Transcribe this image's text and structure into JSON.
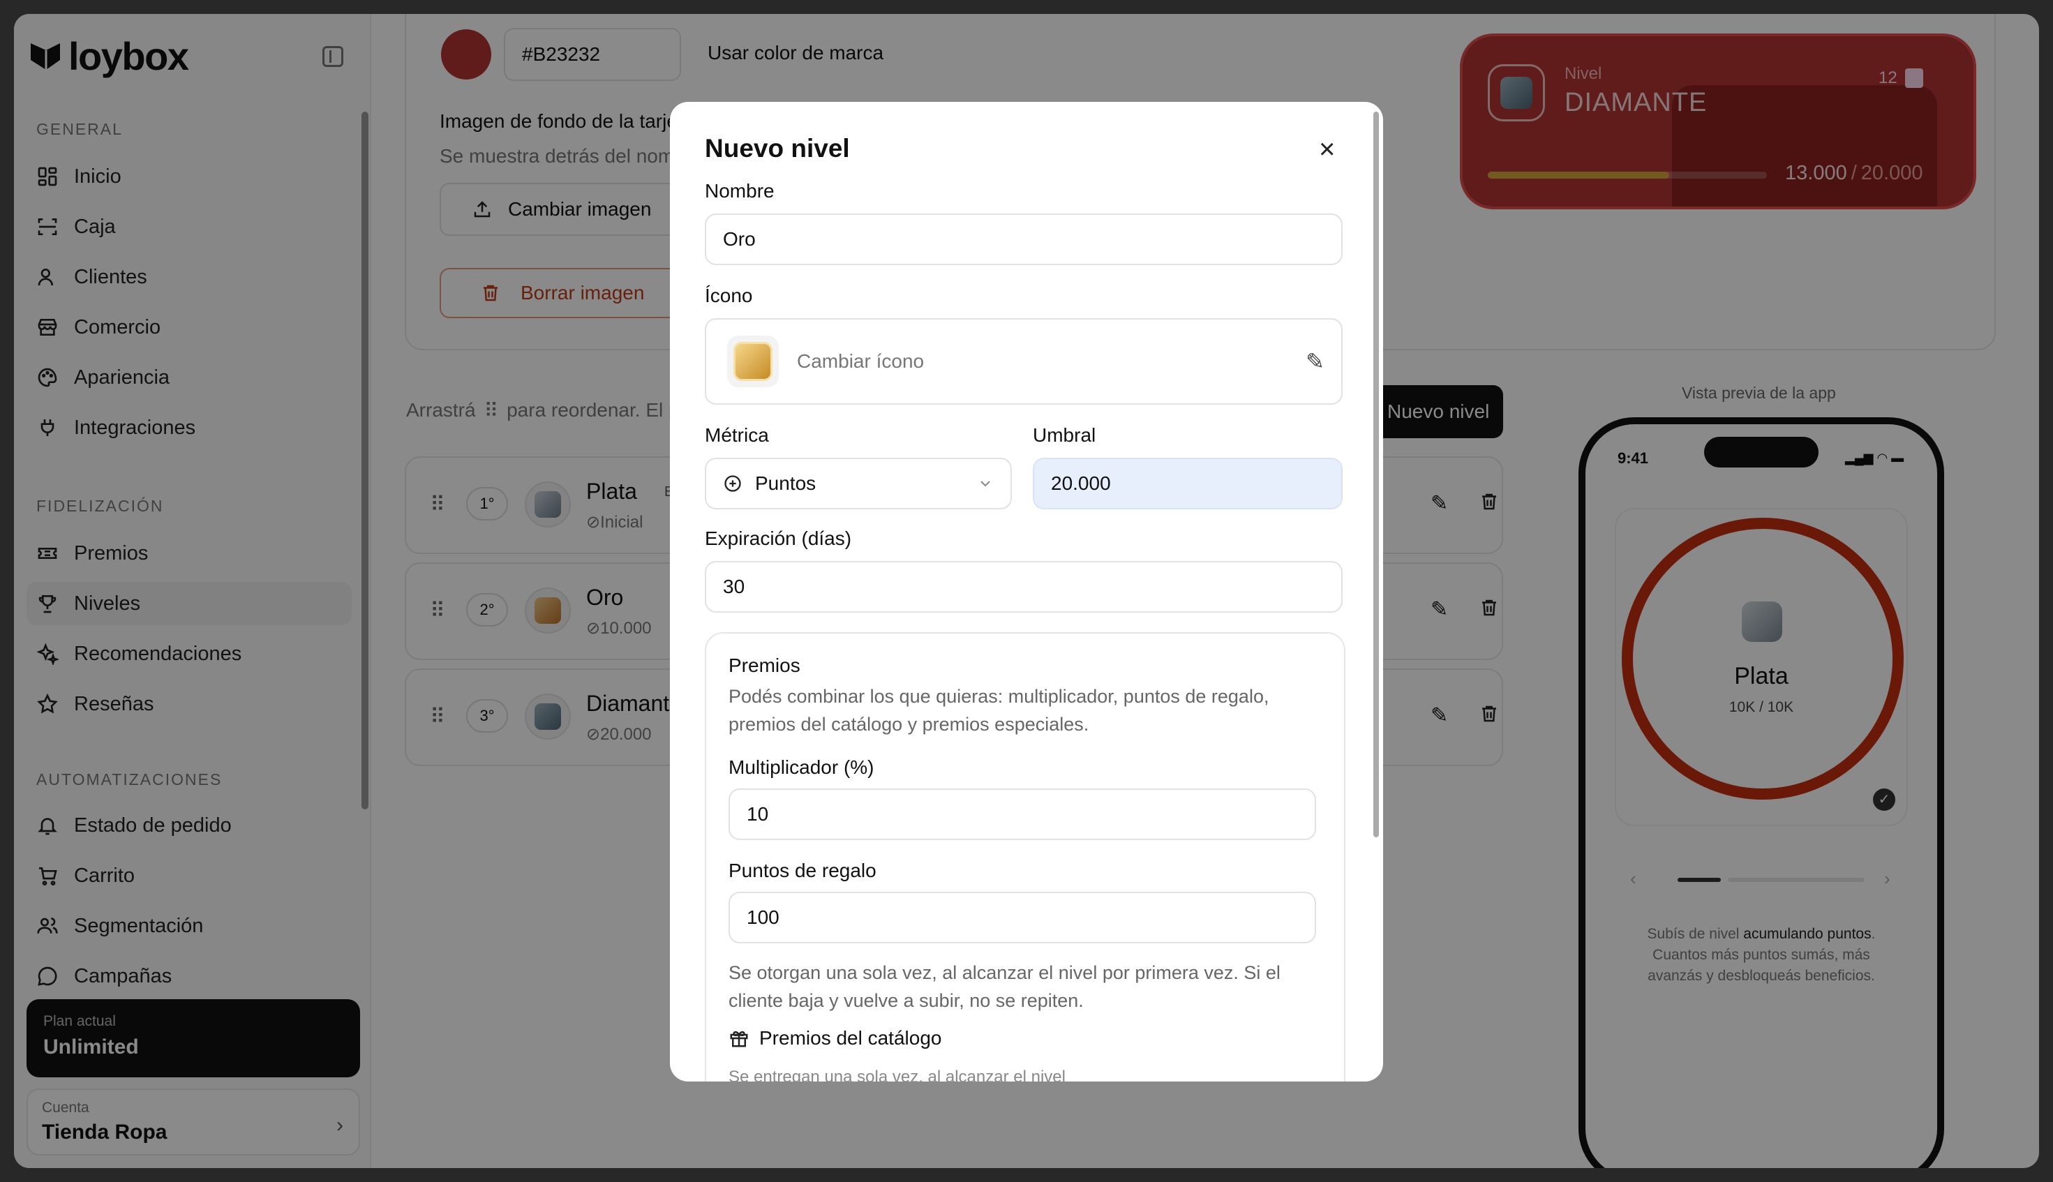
{
  "brand": {
    "name": "loybox"
  },
  "sidebar": {
    "sections": {
      "general": "GENERAL",
      "loyalty": "FIDELIZACIÓN",
      "automation": "AUTOMATIZACIONES"
    },
    "items": [
      {
        "label": "Inicio",
        "icon": "dashboard-icon"
      },
      {
        "label": "Caja",
        "icon": "scan-icon"
      },
      {
        "label": "Clientes",
        "icon": "user-icon"
      },
      {
        "label": "Comercio",
        "icon": "store-icon"
      },
      {
        "label": "Apariencia",
        "icon": "palette-icon"
      },
      {
        "label": "Integraciones",
        "icon": "plug-icon"
      },
      {
        "label": "Premios",
        "icon": "ticket-icon"
      },
      {
        "label": "Niveles",
        "icon": "trophy-icon"
      },
      {
        "label": "Recomendaciones",
        "icon": "sparkles-icon"
      },
      {
        "label": "Reseñas",
        "icon": "star-icon"
      },
      {
        "label": "Estado de pedido",
        "icon": "bell-icon"
      },
      {
        "label": "Carrito",
        "icon": "cart-icon"
      },
      {
        "label": "Segmentación",
        "icon": "users-icon"
      },
      {
        "label": "Campañas",
        "icon": "chat-icon"
      }
    ],
    "plan": {
      "label": "Plan actual",
      "value": "Unlimited"
    },
    "account": {
      "label": "Cuenta",
      "value": "Tienda Ropa"
    }
  },
  "appearance": {
    "color_hex": "#B23232",
    "use_brand_color": "Usar color de marca",
    "bg_title": "Imagen de fondo de la tarje",
    "bg_desc": "Se muestra detrás del nom",
    "change_image": "Cambiar imagen",
    "delete_image": "Borrar imagen"
  },
  "levels": {
    "hint_prefix": "Arrastrá",
    "hint_suffix": "para reordenar. El p",
    "new_level_button": "Nuevo nivel",
    "list": [
      {
        "rank": "1°",
        "name": "Plata",
        "threshold": "Inicial",
        "badge": "B",
        "color1": "#c9d3da",
        "color2": "#6f7f8a"
      },
      {
        "rank": "2°",
        "name": "Oro",
        "threshold": "10.000",
        "color1": "#f2c98a",
        "color2": "#b9742a"
      },
      {
        "rank": "3°",
        "name": "Diamant",
        "threshold": "20.000",
        "color1": "#9fb3bf",
        "color2": "#4f6878"
      }
    ]
  },
  "tier_card": {
    "label": "Nivel",
    "name": "DIAMANTE",
    "count": "12",
    "current": "13.000",
    "sep": "/",
    "total": "20.000",
    "progress": 0.65,
    "color": "#B23232"
  },
  "preview": {
    "title": "Vista previa de la app",
    "time": "9:41",
    "level_name": "Plata",
    "level_progress": "10K / 10K",
    "desc_part1": "Subís de nivel",
    "desc_bold": "acumulando puntos",
    "desc_part2": ". Cuantos más puntos sumás, más avanzás y desbloqueás beneficios."
  },
  "modal": {
    "title": "Nuevo nivel",
    "name_label": "Nombre",
    "name_value": "Oro",
    "icon_label": "Ícono",
    "change_icon": "Cambiar ícono",
    "metric_label": "Métrica",
    "metric_value": "Puntos",
    "threshold_label": "Umbral",
    "threshold_value": "20.000",
    "expiration_label": "Expiración (días)",
    "expiration_value": "30",
    "rewards": {
      "title": "Premios",
      "desc": "Podés combinar los que quieras: multiplicador, puntos de regalo, premios del catálogo y premios especiales.",
      "multiplier_label": "Multiplicador (%)",
      "multiplier_value": "10",
      "gift_points_label": "Puntos de regalo",
      "gift_points_value": "100",
      "gift_points_help": "Se otorgan una sola vez, al alcanzar el nivel por primera vez. Si el cliente baja y vuelve a subir, no se repiten.",
      "catalog_title": "Premios del catálogo",
      "catalog_help": "Se entregan una sola vez, al alcanzar el nivel"
    }
  }
}
